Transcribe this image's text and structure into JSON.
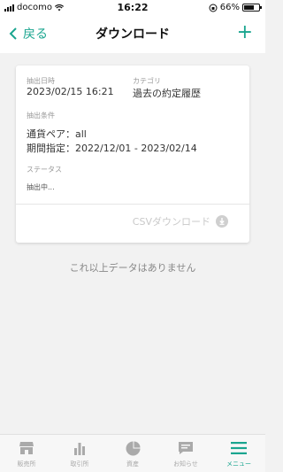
{
  "status_bar": {
    "carrier": "docomo",
    "time": "16:22",
    "battery_percent": "66%",
    "battery_level": 0.66
  },
  "nav": {
    "back_label": "戻る",
    "title": "ダウンロード",
    "add_label": "+"
  },
  "record": {
    "extract_date_label": "抽出日時",
    "extract_date_value": "2023/02/15 16:21",
    "category_label": "カテゴリ",
    "category_value": "過去の約定履歴",
    "conditions_label": "抽出条件",
    "pair_line": "通貨ペア：all",
    "period_line": "期間指定：2022/12/01 - 2023/02/14",
    "status_label": "ステータス",
    "status_value": "抽出中...",
    "csv_button_label": "CSVダウンロード"
  },
  "empty_message": "これ以上データはありません",
  "tabs": [
    {
      "label": "販売所",
      "icon": "shop-icon",
      "active": false
    },
    {
      "label": "取引所",
      "icon": "bar-chart-icon",
      "active": false
    },
    {
      "label": "資産",
      "icon": "pie-chart-icon",
      "active": false
    },
    {
      "label": "お知らせ",
      "icon": "message-icon",
      "active": false
    },
    {
      "label": "メニュー",
      "icon": "menu-icon",
      "active": true
    }
  ],
  "colors": {
    "accent": "#1aa58f",
    "inactive": "#aaaaaa",
    "disabled": "#c9c9c9"
  }
}
